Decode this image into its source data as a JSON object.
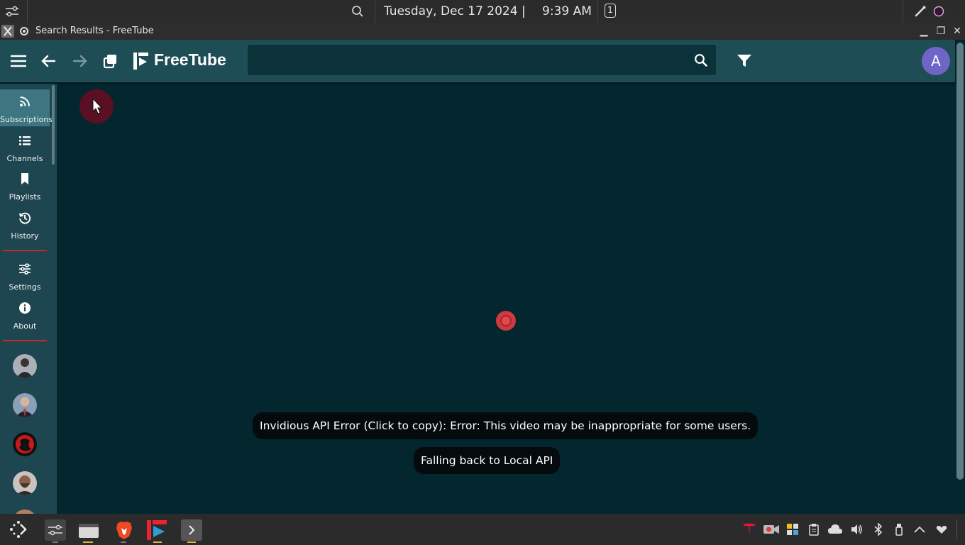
{
  "system_bar": {
    "date": "Tuesday, Dec 17 2024",
    "separator": "|",
    "time": "9:39 AM",
    "workspace": "1"
  },
  "window": {
    "title": "Search Results - FreeTube",
    "minimize": "▁",
    "maximize": "❐",
    "close": "✕"
  },
  "header": {
    "logo_text": "FreeTube",
    "search_value": "",
    "avatar_letter": "A"
  },
  "sidebar": {
    "items": [
      {
        "label": "Subscriptions",
        "icon": "rss-icon",
        "active": true
      },
      {
        "label": "Channels",
        "icon": "list-icon"
      },
      {
        "label": "Playlists",
        "icon": "bookmark-icon"
      },
      {
        "label": "History",
        "icon": "history-icon"
      },
      {
        "label": "Settings",
        "icon": "sliders-icon"
      },
      {
        "label": "About",
        "icon": "info-icon"
      }
    ],
    "channels": [
      "channel-avatar-1",
      "channel-avatar-2",
      "channel-avatar-3",
      "channel-avatar-4"
    ]
  },
  "toasts": {
    "error": "Invidious API Error (Click to copy): Error: This video may be inappropriate for some users.",
    "fallback": "Falling back to Local API"
  },
  "colors": {
    "header": "#1f4d56",
    "main": "#03262f",
    "sidebar": "#1e4650",
    "accent": "#c62828",
    "avatar": "#6e65c7"
  }
}
